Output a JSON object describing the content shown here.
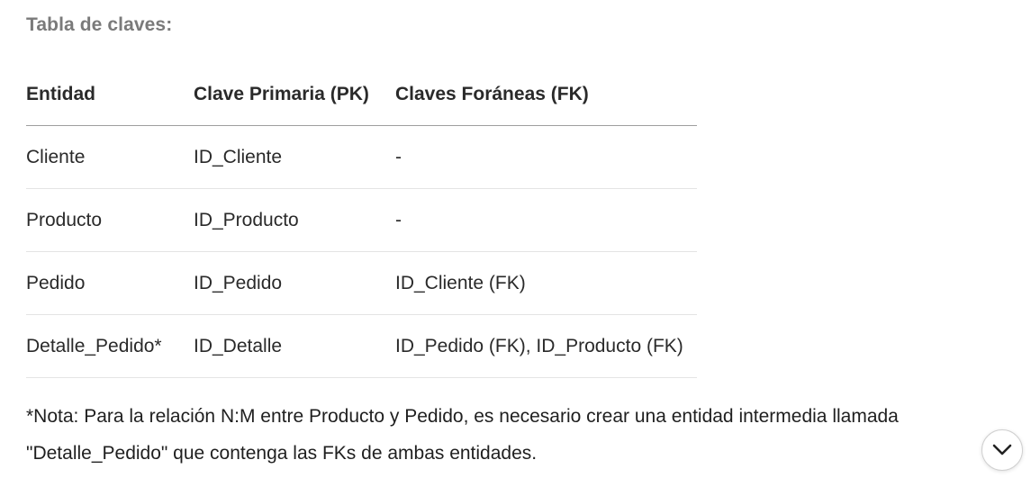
{
  "section_title": "Tabla de claves:",
  "table": {
    "headers": {
      "entity": "Entidad",
      "pk": "Clave Primaria (PK)",
      "fk": "Claves Foráneas (FK)"
    },
    "rows": [
      {
        "entity": "Cliente",
        "pk": "ID_Cliente",
        "fk": "-"
      },
      {
        "entity": "Producto",
        "pk": "ID_Producto",
        "fk": "-"
      },
      {
        "entity": "Pedido",
        "pk": "ID_Pedido",
        "fk": "ID_Cliente (FK)"
      },
      {
        "entity": "Detalle_Pedido*",
        "pk": "ID_Detalle",
        "fk": "ID_Pedido (FK), ID_Producto (FK)"
      }
    ]
  },
  "note": "*Nota: Para la relación N:M entre Producto y Pedido, es necesario crear una entidad intermedia llamada \"Detalle_Pedido\" que contenga las FKs de ambas entidades.",
  "scroll_button": {
    "icon": "chevron-down-icon"
  }
}
